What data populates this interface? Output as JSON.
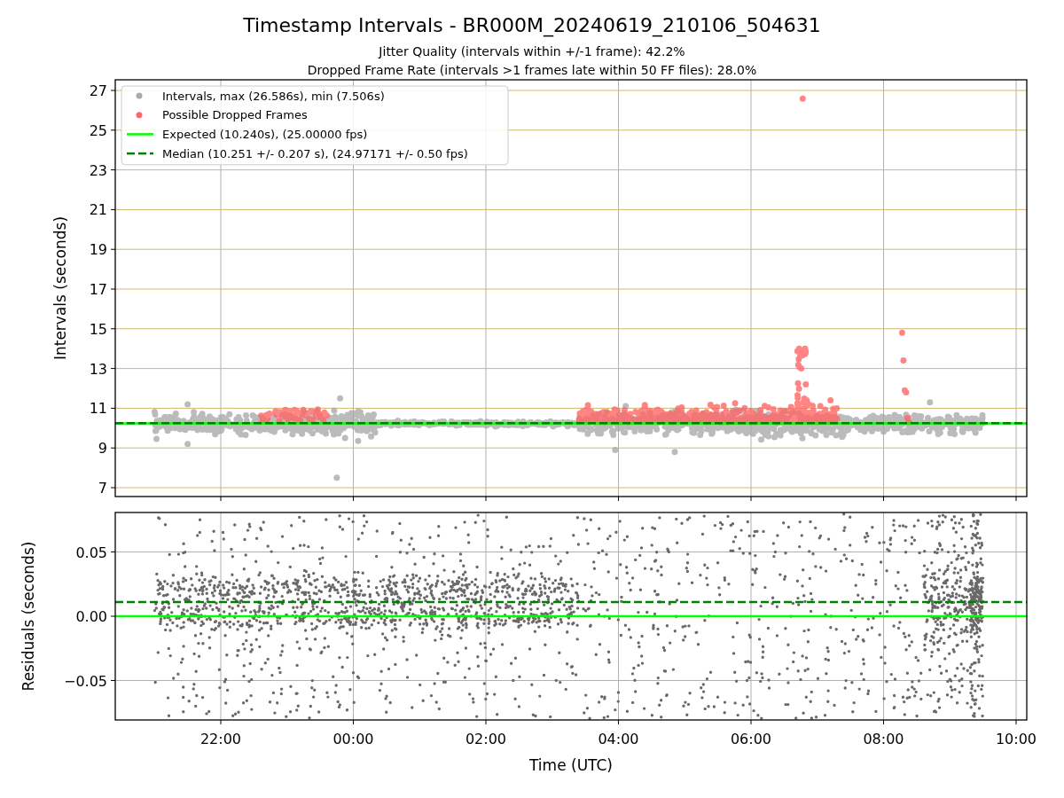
{
  "figure": {
    "title": "Timestamp Intervals - BR000M_20240619_210106_504631",
    "subtitles": [
      "Jitter Quality (intervals within +/-1 frame): 42.2%",
      "Dropped Frame Rate (intervals >1 frames late within 50 FF files): 28.0%"
    ]
  },
  "intervals_plot": {
    "y_axis_label": "Intervals (seconds)",
    "y_tick_labels": [
      "27",
      "25",
      "23",
      "21",
      "19",
      "17",
      "15",
      "13",
      "11",
      "9",
      "7"
    ],
    "legend": [
      {
        "label": "Intervals, max (26.586s), min (7.506s)",
        "kind": "marker",
        "color": "#aaaaaa"
      },
      {
        "label": "Possible Dropped Frames",
        "kind": "marker",
        "color": "#ff6666"
      },
      {
        "label": "Expected (10.240s), (25.00000 fps)",
        "kind": "line",
        "color": "#00ff00"
      },
      {
        "label": "Median (10.251 +/- 0.207 s), (24.97171 +/- 0.50 fps)",
        "kind": "dashed",
        "color": "#008000"
      }
    ]
  },
  "residuals_plot": {
    "y_axis_label": "Residuals (seconds)",
    "y_tick_labels": [
      "0.05",
      "0.00",
      "−0.05"
    ],
    "x_tick_labels": [
      "22:00",
      "00:00",
      "02:00",
      "04:00",
      "06:00",
      "08:00",
      "10:00"
    ],
    "x_axis_label": "Time (UTC)"
  }
}
